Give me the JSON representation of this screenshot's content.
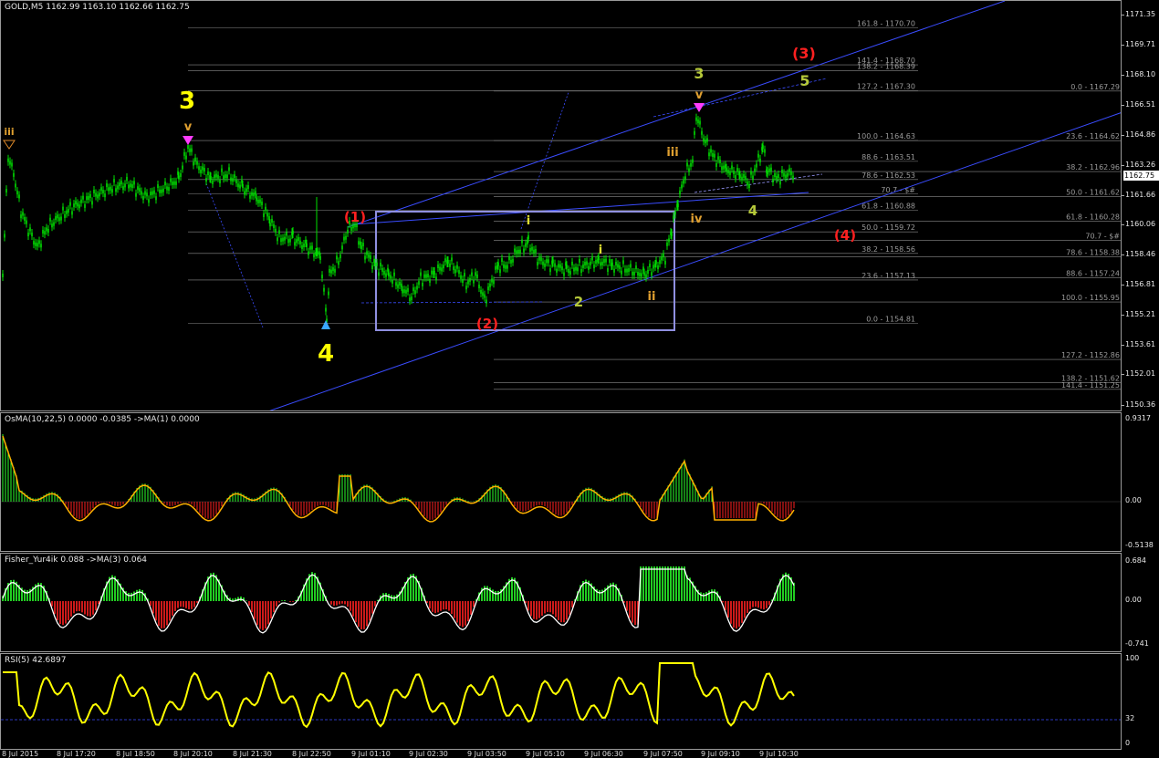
{
  "main": {
    "title": "GOLD,M5  1162.99 1163.10 1162.66 1162.75",
    "current_price": "1162.75",
    "price_ticks": [
      "1171.35",
      "1169.71",
      "1168.10",
      "1166.51",
      "1164.86",
      "1163.26",
      "1161.66",
      "1160.06",
      "1158.46",
      "1156.81",
      "1155.21",
      "1153.61",
      "1152.01",
      "1150.36"
    ],
    "fib_labels_left": [
      {
        "text": "161.8 - 1170.70",
        "price": 1170.7
      },
      {
        "text": "141.4 - 1168.70",
        "price": 1168.7
      },
      {
        "text": "138.2 - 1168.39",
        "price": 1168.39
      },
      {
        "text": "127.2 - 1167.30",
        "price": 1167.3
      },
      {
        "text": "100.0 - 1164.63",
        "price": 1164.63
      },
      {
        "text": "88.6 - 1163.51",
        "price": 1163.51
      },
      {
        "text": "78.6 - 1162.53",
        "price": 1162.53
      },
      {
        "text": "70.7 - $#",
        "price": 1161.75
      },
      {
        "text": "61.8 - 1160.88",
        "price": 1160.88
      },
      {
        "text": "50.0 - 1159.72",
        "price": 1159.72
      },
      {
        "text": "38.2 - 1158.56",
        "price": 1158.56
      },
      {
        "text": "23.6 - 1157.13",
        "price": 1157.13
      },
      {
        "text": "0.0 - 1154.81",
        "price": 1154.81
      }
    ],
    "fib_labels_right": [
      {
        "text": "0.0 - 1167.29",
        "price": 1167.29
      },
      {
        "text": "23.6 - 1164.62",
        "price": 1164.62
      },
      {
        "text": "38.2 - 1162.96",
        "price": 1162.96
      },
      {
        "text": "50.0 - 1161.62",
        "price": 1161.62
      },
      {
        "text": "61.8 - 1160.28",
        "price": 1160.28
      },
      {
        "text": "70.7 - $#",
        "price": 1159.27
      },
      {
        "text": "78.6 - 1158.38",
        "price": 1158.38
      },
      {
        "text": "88.6 - 1157.24",
        "price": 1157.24
      },
      {
        "text": "100.0 - 1155.95",
        "price": 1155.95
      },
      {
        "text": "127.2 - 1152.86",
        "price": 1152.86
      },
      {
        "text": "138.2 - 1151.62",
        "price": 1151.62
      },
      {
        "text": "141.4 - 1151.25",
        "price": 1151.25
      }
    ],
    "wave_labels": {
      "big3": "3",
      "big4": "4",
      "small_iii_left": "iii",
      "v_left": "v",
      "red1": "(1)",
      "red2": "(2)",
      "red3": "(3)",
      "red4": "(4)",
      "g3": "3",
      "g5": "5",
      "g4": "4",
      "g2": "2",
      "v_right": "v",
      "iii_right": "iii",
      "iv_right": "iv",
      "ii_right": "ii",
      "i_small": "i",
      "i_small2": "i"
    },
    "colors": {
      "candle": "#00e000",
      "trend": "#3a4cff",
      "fib": "#8a8a8a",
      "box": "#8f8fe0",
      "yellow": "#ffff00",
      "red": "#ff2020",
      "olive": "#b5c83a",
      "magenta": "#ff3cff"
    }
  },
  "osma": {
    "title": "OsMA(10,22,5) 0.0000 -0.0385  ->MA(1) 0.0000",
    "ticks": [
      "0.9317",
      "0.00",
      "-0.5138"
    ]
  },
  "fisher": {
    "title": "Fisher_Yur4ik 0.088  ->MA(3) 0.064",
    "ticks": [
      "0.684",
      "0.00",
      "-0.741"
    ]
  },
  "rsi": {
    "title": "RSI(5) 42.6897",
    "ticks": [
      "100",
      "32",
      "0"
    ]
  },
  "time_labels": [
    "8 Jul 2015",
    "8 Jul 17:20",
    "8 Jul 18:50",
    "8 Jul 20:10",
    "8 Jul 21:30",
    "8 Jul 22:50",
    "9 Jul 01:10",
    "9 Jul 02:30",
    "9 Jul 03:50",
    "9 Jul 05:10",
    "9 Jul 06:30",
    "9 Jul 07:50",
    "9 Jul 09:10",
    "9 Jul 10:30"
  ],
  "chart_data": {
    "type": "line",
    "title": "GOLD,M5",
    "xlabel": "",
    "ylabel": "",
    "ylim": [
      1150.0,
      1171.8
    ],
    "x": [
      "8 Jul 2015",
      "8 Jul 17:20",
      "8 Jul 18:50",
      "8 Jul 20:10",
      "8 Jul 21:30",
      "8 Jul 22:50",
      "9 Jul 01:10",
      "9 Jul 02:30",
      "9 Jul 03:50",
      "9 Jul 05:10",
      "9 Jul 06:30",
      "9 Jul 07:50",
      "9 Jul 09:10",
      "9 Jul 10:30"
    ],
    "series": [
      {
        "name": "GOLD",
        "values": [
          1161.5,
          1161.6,
          1162.0,
          1163.8,
          1161.3,
          1159.0,
          1160.2,
          1157.6,
          1158.0,
          1158.4,
          1158.6,
          1161.0,
          1163.4,
          1162.75
        ]
      }
    ],
    "grid": false
  }
}
